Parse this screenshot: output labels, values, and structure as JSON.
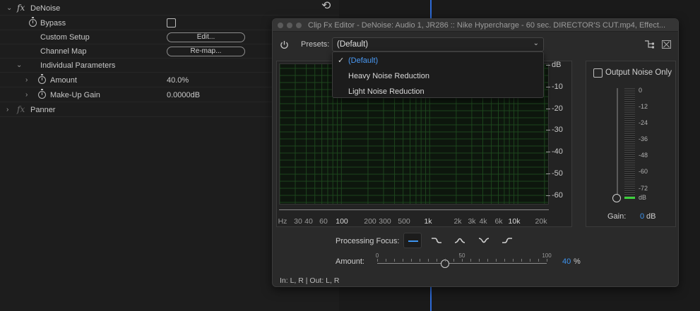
{
  "effect_controls": {
    "effect_name": "DeNoise",
    "fx_symbol": "fx",
    "rows": {
      "bypass": {
        "label": "Bypass"
      },
      "custom_setup": {
        "label": "Custom Setup",
        "button": "Edit..."
      },
      "channel_map": {
        "label": "Channel Map",
        "button": "Re-map..."
      },
      "individual_parameters": {
        "label": "Individual Parameters"
      },
      "amount": {
        "label": "Amount",
        "value": "40.0%"
      },
      "makeup_gain": {
        "label": "Make-Up Gain",
        "value": "0.0000dB"
      }
    },
    "panner": {
      "label": "Panner"
    }
  },
  "fx_window": {
    "title": "Clip Fx Editor - DeNoise: Audio 1, JR286 :: Nike Hypercharge - 60 sec. DIRECTOR'S CUT.mp4, Effect...",
    "presets_label": "Presets:",
    "presets_value": "(Default)",
    "preset_menu": {
      "items": [
        "(Default)",
        "Heavy Noise Reduction",
        "Light Noise Reduction"
      ],
      "selected": "(Default)"
    },
    "graph": {
      "db_labels": [
        "dB",
        "-10",
        "-20",
        "-30",
        "-40",
        "-50",
        "-60"
      ],
      "hz_labels": [
        "Hz",
        "30",
        "40",
        "60",
        "100",
        "200",
        "300",
        "500",
        "1k",
        "2k",
        "3k",
        "4k",
        "6k",
        "10k",
        "20k"
      ],
      "grid_color": "#1f4a1f",
      "background_color": "#0d160d"
    },
    "output_noise": {
      "label": "Output Noise Only",
      "checked": false,
      "meter_scale": [
        "0",
        "-12",
        "-24",
        "-36",
        "-48",
        "-60",
        "-72"
      ],
      "meter_unit": "dB",
      "gain_label": "Gain:",
      "gain_value": "0",
      "gain_unit": "dB",
      "meter_color": "#3ed13e"
    },
    "processing_focus": {
      "label": "Processing Focus:",
      "options": [
        "flat-focus-icon",
        "low-focus-icon",
        "mid-focus-icon",
        "notch-focus-icon",
        "high-focus-icon"
      ],
      "selected_index": 0,
      "accent": "#3d94ef"
    },
    "amount": {
      "label": "Amount:",
      "scale": [
        "0",
        "50",
        "100"
      ],
      "value": "40",
      "unit": "%",
      "value_fraction": 0.4
    },
    "io_status": "In: L, R | Out: L, R"
  }
}
